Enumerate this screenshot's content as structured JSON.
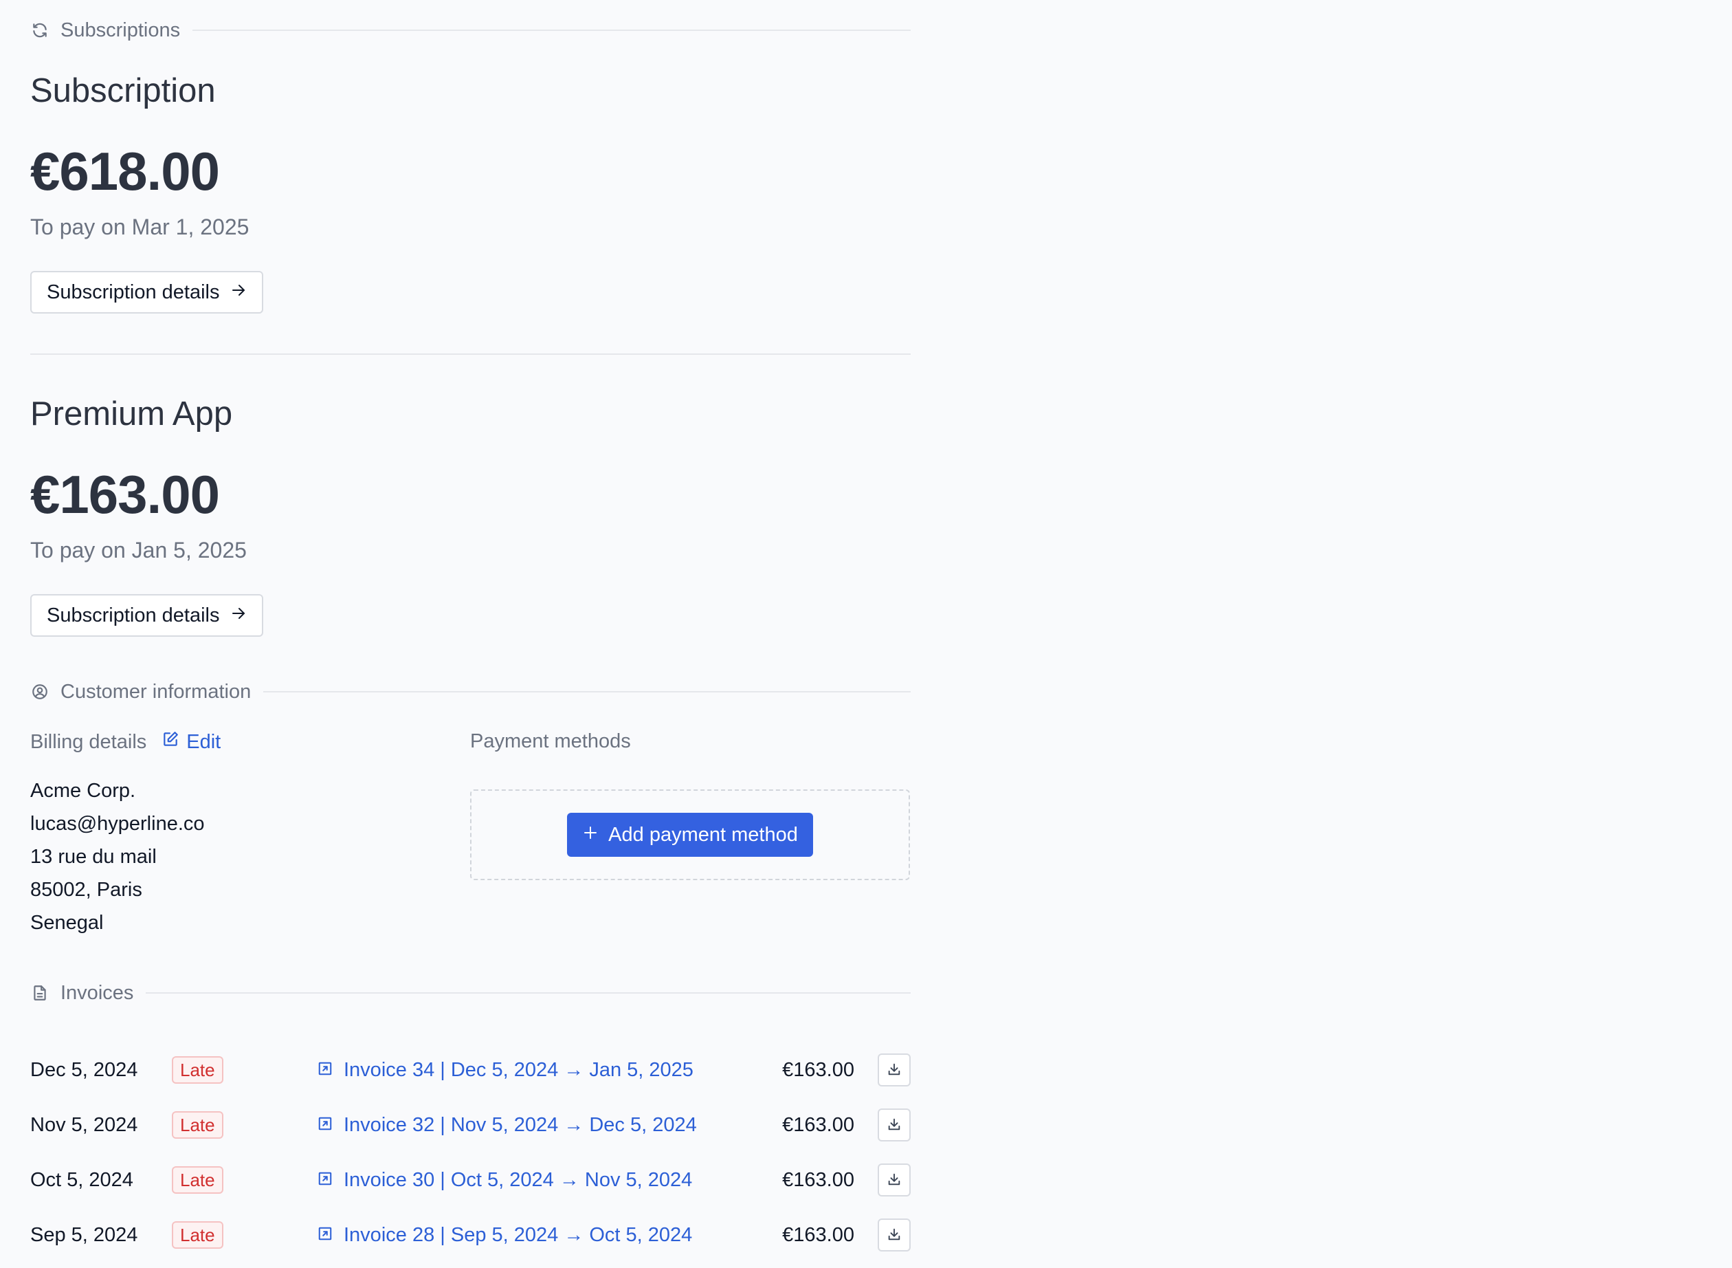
{
  "sections": {
    "subscriptions": {
      "label": "Subscriptions",
      "icon": "refresh-icon"
    },
    "customer": {
      "label": "Customer information",
      "icon": "user-circle-icon"
    },
    "invoices": {
      "label": "Invoices",
      "icon": "document-icon"
    }
  },
  "subscriptions": [
    {
      "title": "Subscription",
      "amount": "€618.00",
      "due": "To pay on Mar 1, 2025",
      "button_label": "Subscription details",
      "button_icon": "arrow-right-icon"
    },
    {
      "title": "Premium App",
      "amount": "€163.00",
      "due": "To pay on Jan 5, 2025",
      "button_label": "Subscription details",
      "button_icon": "arrow-right-icon"
    }
  ],
  "billing": {
    "label": "Billing details",
    "edit_label": "Edit",
    "edit_icon": "edit-icon",
    "lines": [
      "Acme Corp.",
      "lucas@hyperline.co",
      "13 rue du mail",
      "85002, Paris",
      "Senegal"
    ]
  },
  "payment": {
    "label": "Payment methods",
    "add_label": "Add payment method",
    "add_icon": "plus-icon"
  },
  "invoices": [
    {
      "date": "Dec 5, 2024",
      "status": "Late",
      "link": "Invoice 34 | Dec 5, 2024 → Jan 5, 2025",
      "amount": "€163.00"
    },
    {
      "date": "Nov 5, 2024",
      "status": "Late",
      "link": "Invoice 32 | Nov 5, 2024 → Dec 5, 2024",
      "amount": "€163.00"
    },
    {
      "date": "Oct 5, 2024",
      "status": "Late",
      "link": "Invoice 30 | Oct 5, 2024 → Nov 5, 2024",
      "amount": "€163.00"
    },
    {
      "date": "Sep 5, 2024",
      "status": "Late",
      "link": "Invoice 28 | Sep 5, 2024 → Oct 5, 2024",
      "amount": "€163.00"
    }
  ],
  "colors": {
    "background": "#f9fafc",
    "link": "#2c5fd6",
    "primary": "#3461e0",
    "late_text": "#d12f2f",
    "late_bg": "#fdf2f2"
  }
}
